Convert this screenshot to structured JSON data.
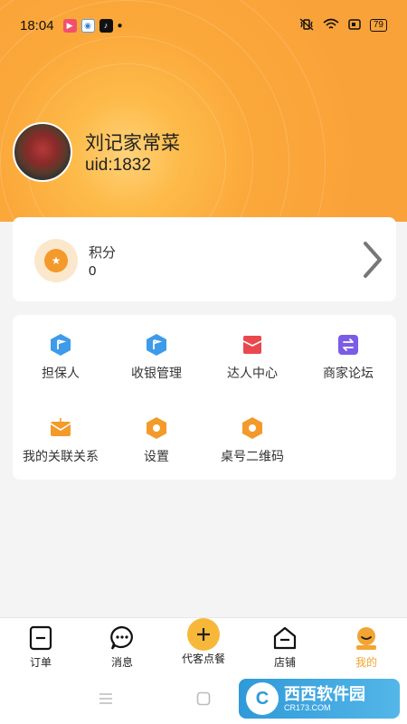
{
  "status_bar": {
    "time": "18:04",
    "battery": "79",
    "app_icons": [
      "video-app-icon",
      "browser-app-icon",
      "tiktok-app-icon"
    ]
  },
  "profile": {
    "store_name": "刘记家常菜",
    "uid": "uid:1832"
  },
  "points": {
    "label": "积分",
    "value": "0"
  },
  "menu": {
    "items": [
      {
        "label": "担保人",
        "icon": "flag-icon",
        "color": "#3d9be9"
      },
      {
        "label": "收银管理",
        "icon": "flag-icon",
        "color": "#3d9be9"
      },
      {
        "label": "达人中心",
        "icon": "envelope-icon",
        "color": "#e9484f"
      },
      {
        "label": "商家论坛",
        "icon": "exchange-icon",
        "color": "#7b5ce6"
      },
      {
        "label": "我的关联关系",
        "icon": "mail-icon",
        "color": "#f39a2a"
      },
      {
        "label": "设置",
        "icon": "hexagon-icon",
        "color": "#f39a2a"
      },
      {
        "label": "桌号二维码",
        "icon": "hexagon-icon",
        "color": "#f39a2a"
      }
    ]
  },
  "bottom_nav": {
    "items": [
      {
        "label": "订单",
        "icon": "order-icon"
      },
      {
        "label": "消息",
        "icon": "message-icon"
      },
      {
        "label": "代客点餐",
        "icon": "plus-icon"
      },
      {
        "label": "店铺",
        "icon": "shop-icon"
      },
      {
        "label": "我的",
        "icon": "profile-icon"
      }
    ],
    "active": "我的"
  },
  "watermark": {
    "logo": "C",
    "title": "西西软件园",
    "url": "CR173.COM"
  },
  "colors": {
    "accent": "#f3a432",
    "header": "#f9a23a"
  }
}
